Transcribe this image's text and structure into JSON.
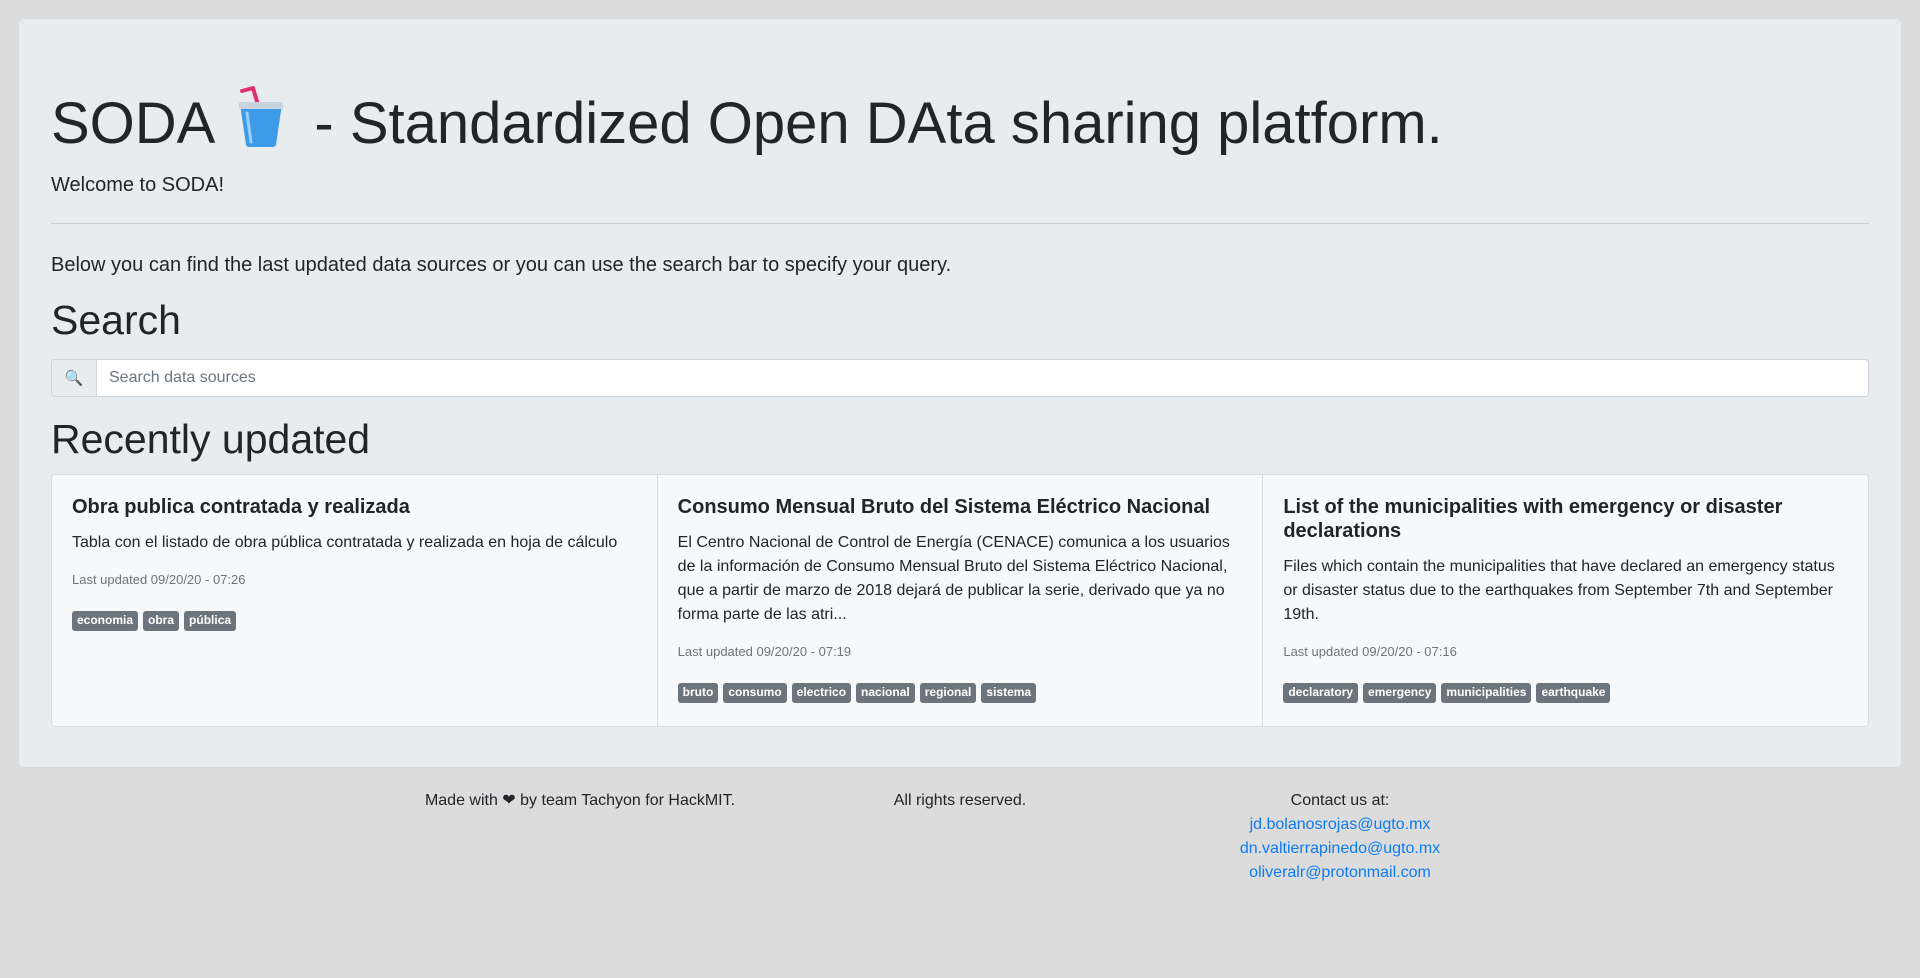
{
  "header": {
    "title_prefix": "SODA",
    "title_suffix": "- Standardized Open DAta sharing platform.",
    "welcome": "Welcome to SODA!"
  },
  "intro": "Below you can find the last updated data sources or you can use the search bar to specify your query.",
  "search": {
    "heading": "Search",
    "icon": "magnifier-icon",
    "placeholder": "Search data sources"
  },
  "recent": {
    "heading": "Recently updated",
    "cards": [
      {
        "title": "Obra publica contratada y realizada",
        "description": "Tabla con el listado de obra pública contratada y realizada en hoja de cálculo",
        "updated": "Last updated 09/20/20 - 07:26",
        "tags": [
          "economia",
          "obra",
          "pública"
        ]
      },
      {
        "title": "Consumo Mensual Bruto del Sistema Eléctrico Nacional",
        "description": "El Centro Nacional de Control de Energía (CENACE) comunica a los usuarios de la información de Consumo Mensual Bruto del Sistema Eléctrico Nacional, que a partir de marzo de 2018 dejará de publicar la serie, derivado que ya no forma parte de las atri...",
        "updated": "Last updated 09/20/20 - 07:19",
        "tags": [
          "bruto",
          "consumo",
          "electrico",
          "nacional",
          "regional",
          "sistema"
        ]
      },
      {
        "title": "List of the municipalities with emergency or disaster declarations",
        "description": "Files which contain the municipalities that have declared an emergency status or disaster status due to the earthquakes from September 7th and September 19th.",
        "updated": "Last updated 09/20/20 - 07:16",
        "tags": [
          "declaratory",
          "emergency",
          "municipalities",
          "earthquake"
        ]
      }
    ]
  },
  "footer": {
    "made_with": "Made with ❤ by team Tachyon for HackMIT.",
    "rights": "All rights reserved.",
    "contact_label": "Contact us at:",
    "emails": [
      "jd.bolanosrojas@ugto.mx",
      "dn.valtierrapinedo@ugto.mx",
      "oliveralr@protonmail.com"
    ]
  },
  "colors": {
    "page_bg": "#dcdcdc",
    "jumbotron_bg": "#e9ecef",
    "tag_bg": "#6c757d",
    "link": "#0d7bf2",
    "cup_body": "#3d9be9",
    "straw": "#e0306d"
  }
}
